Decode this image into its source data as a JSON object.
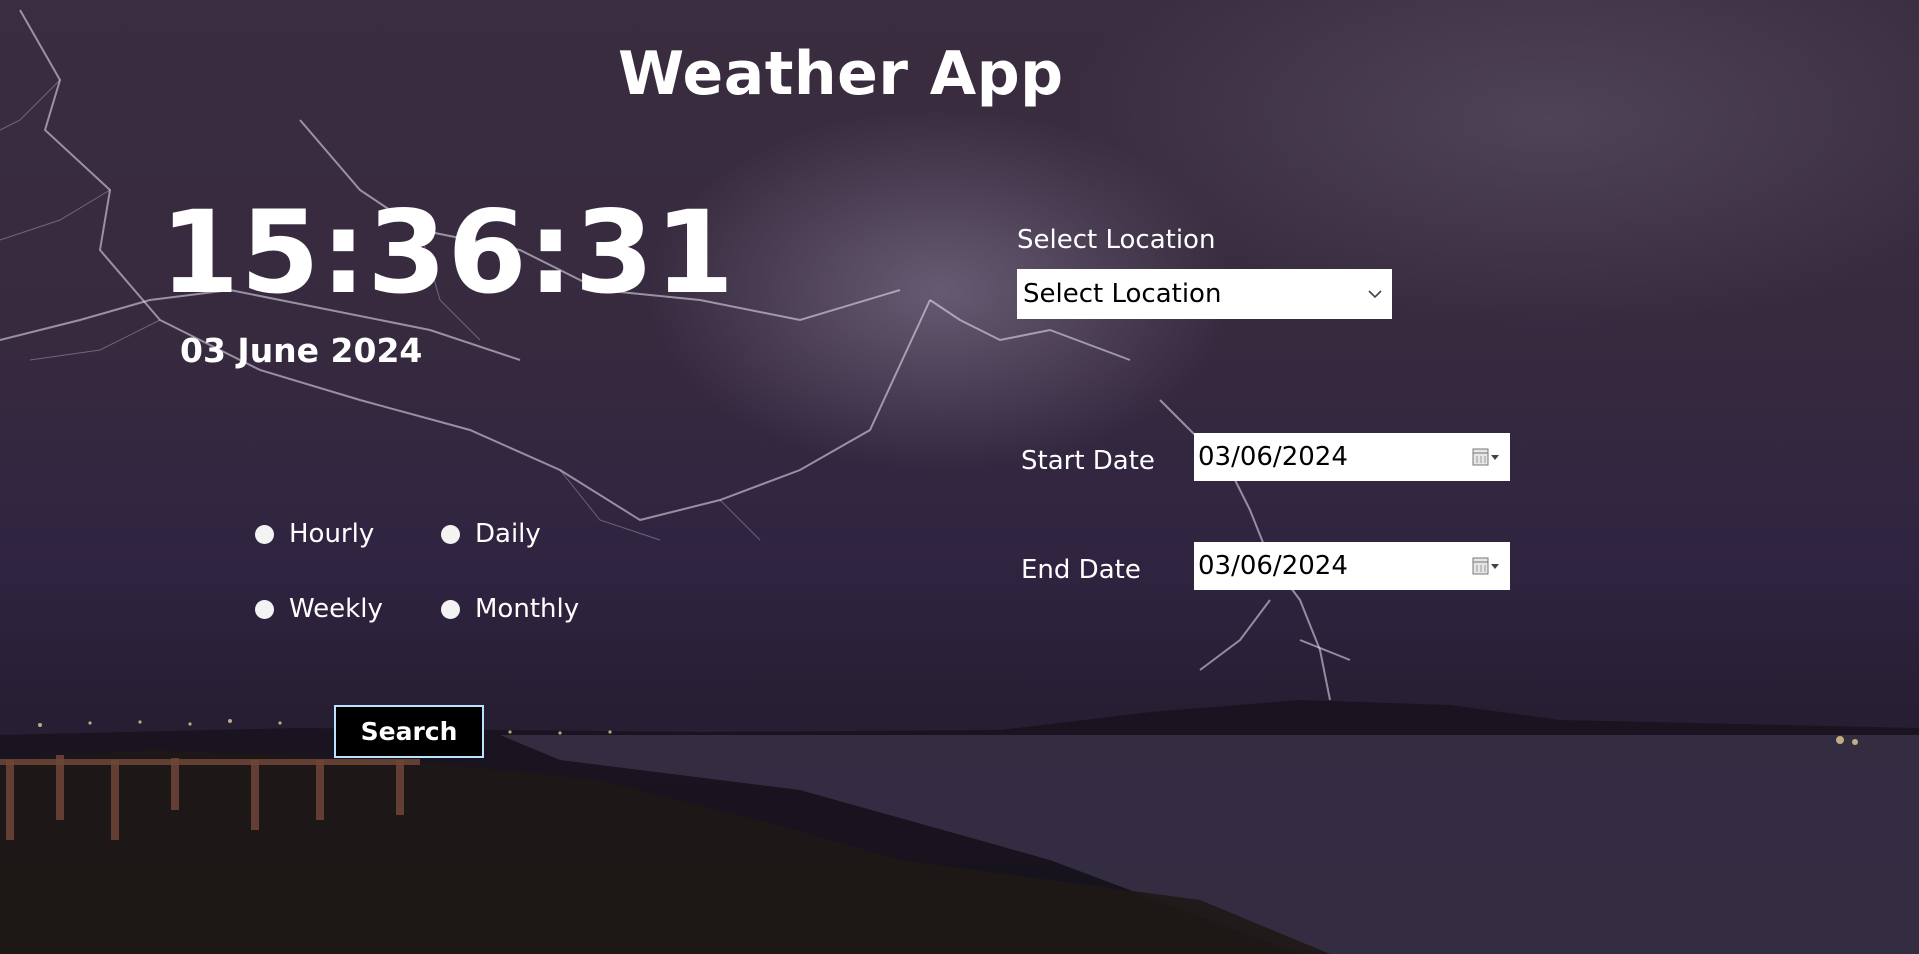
{
  "app": {
    "title": "Weather App"
  },
  "clock": {
    "time": "15:36:31",
    "date": "03 June 2024"
  },
  "frequency": {
    "options": [
      {
        "label": "Hourly",
        "selected": false
      },
      {
        "label": "Daily",
        "selected": false
      },
      {
        "label": "Weekly",
        "selected": false
      },
      {
        "label": "Monthly",
        "selected": false
      }
    ]
  },
  "actions": {
    "search_label": "Search"
  },
  "location": {
    "label": "Select Location",
    "selected_value": "Select Location"
  },
  "dates": {
    "start_label": "Start Date",
    "start_value": "03/06/2024",
    "end_label": "End Date",
    "end_value": "03/06/2024"
  },
  "icons": {
    "location_dropdown": "chevron-down-icon",
    "date_picker": "calendar-icon"
  },
  "colors": {
    "text": "#ffffff",
    "button_bg": "#000000",
    "button_border": "#b8e4ff",
    "field_bg": "#ffffff"
  }
}
